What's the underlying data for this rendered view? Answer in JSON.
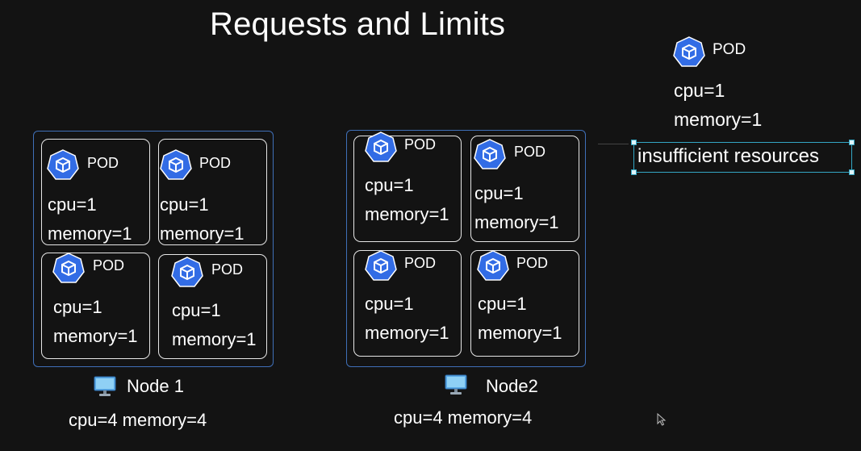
{
  "title": "Requests and Limits",
  "pod_label": "POD",
  "nodes": [
    {
      "name": "Node 1",
      "capacity": "cpu=4 memory=4",
      "pods": [
        {
          "label": "POD",
          "cpu": "cpu=1",
          "memory": "memory=1"
        },
        {
          "label": "POD",
          "cpu": "cpu=1",
          "memory": "memory=1"
        },
        {
          "label": "POD",
          "cpu": "cpu=1",
          "memory": "memory=1"
        },
        {
          "label": "POD",
          "cpu": "cpu=1",
          "memory": "memory=1"
        }
      ]
    },
    {
      "name": "Node2",
      "capacity": "cpu=4 memory=4",
      "pods": [
        {
          "label": "POD",
          "cpu": "cpu=1",
          "memory": "memory=1"
        },
        {
          "label": "POD",
          "cpu": "cpu=1",
          "memory": "memory=1"
        },
        {
          "label": "POD",
          "cpu": "cpu=1",
          "memory": "memory=1"
        },
        {
          "label": "POD",
          "cpu": "cpu=1",
          "memory": "memory=1"
        }
      ]
    }
  ],
  "pending_pod": {
    "label": "POD",
    "cpu": "cpu=1",
    "memory": "memory=1",
    "status": "insufficient resources"
  },
  "icons": {
    "pod": "kubernetes-pod-hexagon-icon",
    "node": "monitor-node-icon",
    "cursor": "mouse-pointer-icon"
  },
  "colors": {
    "background": "#131313",
    "node_border": "#3f6fb8",
    "pod_border": "#e6e6e6",
    "pod_icon": "#326ce5",
    "selection": "#34a7c4",
    "text": "#ffffff"
  }
}
